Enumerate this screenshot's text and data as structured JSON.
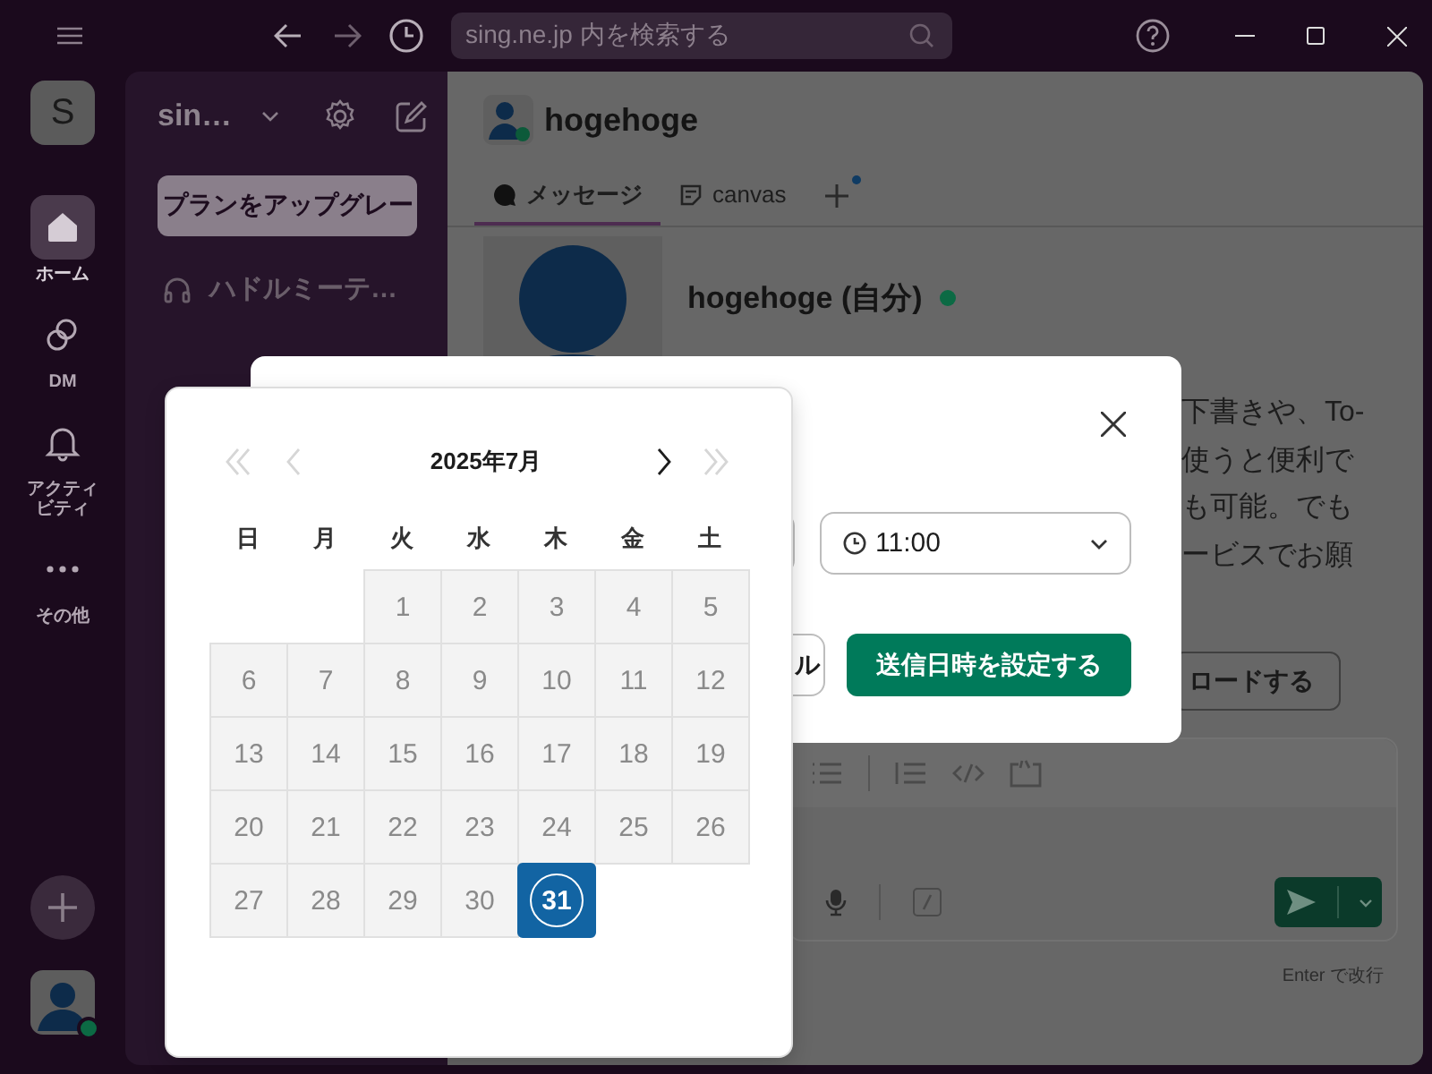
{
  "titlebar": {
    "search": {
      "placeholder": "sing.ne.jp 内を検索する"
    }
  },
  "rail": {
    "workspace": "S",
    "items": [
      {
        "kind": "home",
        "label": "ホーム",
        "selected": true
      },
      {
        "kind": "dm",
        "label": "DM",
        "selected": false
      },
      {
        "kind": "activity",
        "label": "アクティビティ",
        "selected": false
      },
      {
        "kind": "more",
        "label": "その他",
        "selected": false
      }
    ],
    "user": {
      "online": true
    }
  },
  "sidebar": {
    "workspace": "sin…",
    "upgrade_button": "プランをアップグレー",
    "items": [
      {
        "kind": "huddle",
        "label": "ハドルミーテ…"
      }
    ]
  },
  "channel": {
    "title": "hogehoge",
    "tabs": [
      {
        "kind": "messages",
        "label": "メッセージ",
        "selected": true
      },
      {
        "kind": "canvas",
        "label": "canvas",
        "selected": false
      }
    ],
    "add_tab": {
      "badge": true
    }
  },
  "profile": {
    "name": "hogehoge (自分)",
    "online": true,
    "description_lines": [
      "下書きや、To-",
      "使うと便利で",
      "も可能。でも",
      "ービスでお願"
    ],
    "upload_button": "ロードする"
  },
  "composer": {
    "hint": "Enter で改行"
  },
  "modal": {
    "time_select": {
      "value": "11:00"
    },
    "cancel_button": "ル",
    "submit_button": "送信日時を設定する"
  },
  "calendar": {
    "title": "2025年7月",
    "nav": [
      {
        "kind": "prev_year",
        "disabled": true
      },
      {
        "kind": "prev_month",
        "disabled": true
      },
      {
        "kind": "next_month",
        "disabled": false
      },
      {
        "kind": "next_year",
        "disabled": true
      }
    ],
    "weekdays": [
      "日",
      "月",
      "火",
      "水",
      "木",
      "金",
      "土"
    ],
    "weeks": [
      [
        {
          "kind": "blank"
        },
        {
          "kind": "blank"
        },
        {
          "kind": "day",
          "day": "1",
          "disabled": true,
          "selected": false
        },
        {
          "kind": "day",
          "day": "2",
          "disabled": true,
          "selected": false
        },
        {
          "kind": "day",
          "day": "3",
          "disabled": true,
          "selected": false
        },
        {
          "kind": "day",
          "day": "4",
          "disabled": true,
          "selected": false
        },
        {
          "kind": "day",
          "day": "5",
          "disabled": true,
          "selected": false
        }
      ],
      [
        {
          "kind": "day",
          "day": "6",
          "disabled": true,
          "selected": false
        },
        {
          "kind": "day",
          "day": "7",
          "disabled": true,
          "selected": false
        },
        {
          "kind": "day",
          "day": "8",
          "disabled": true,
          "selected": false
        },
        {
          "kind": "day",
          "day": "9",
          "disabled": true,
          "selected": false
        },
        {
          "kind": "day",
          "day": "10",
          "disabled": true,
          "selected": false
        },
        {
          "kind": "day",
          "day": "11",
          "disabled": true,
          "selected": false
        },
        {
          "kind": "day",
          "day": "12",
          "disabled": true,
          "selected": false
        }
      ],
      [
        {
          "kind": "day",
          "day": "13",
          "disabled": true,
          "selected": false
        },
        {
          "kind": "day",
          "day": "14",
          "disabled": true,
          "selected": false
        },
        {
          "kind": "day",
          "day": "15",
          "disabled": true,
          "selected": false
        },
        {
          "kind": "day",
          "day": "16",
          "disabled": true,
          "selected": false
        },
        {
          "kind": "day",
          "day": "17",
          "disabled": true,
          "selected": false
        },
        {
          "kind": "day",
          "day": "18",
          "disabled": true,
          "selected": false
        },
        {
          "kind": "day",
          "day": "19",
          "disabled": true,
          "selected": false
        }
      ],
      [
        {
          "kind": "day",
          "day": "20",
          "disabled": true,
          "selected": false
        },
        {
          "kind": "day",
          "day": "21",
          "disabled": true,
          "selected": false
        },
        {
          "kind": "day",
          "day": "22",
          "disabled": true,
          "selected": false
        },
        {
          "kind": "day",
          "day": "23",
          "disabled": true,
          "selected": false
        },
        {
          "kind": "day",
          "day": "24",
          "disabled": true,
          "selected": false
        },
        {
          "kind": "day",
          "day": "25",
          "disabled": true,
          "selected": false
        },
        {
          "kind": "day",
          "day": "26",
          "disabled": true,
          "selected": false
        }
      ],
      [
        {
          "kind": "day",
          "day": "27",
          "disabled": true,
          "selected": false
        },
        {
          "kind": "day",
          "day": "28",
          "disabled": true,
          "selected": false
        },
        {
          "kind": "day",
          "day": "29",
          "disabled": true,
          "selected": false
        },
        {
          "kind": "day",
          "day": "30",
          "disabled": true,
          "selected": false
        },
        {
          "kind": "day",
          "day": "31",
          "disabled": false,
          "selected": true
        }
      ]
    ]
  }
}
